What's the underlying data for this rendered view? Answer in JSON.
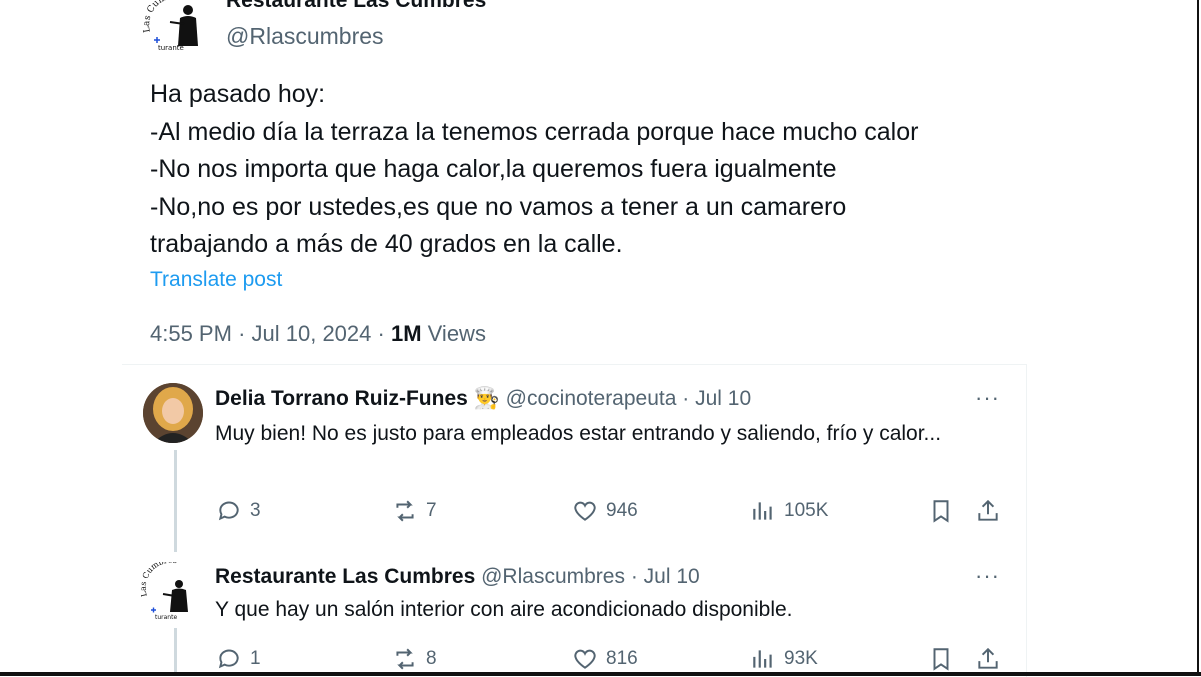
{
  "post": {
    "author_name": "Restaurante Las Cumbres",
    "author_handle": "@Rlascumbres",
    "lines": [
      "Ha pasado hoy:",
      "-Al medio día la terraza la tenemos cerrada porque hace mucho calor",
      "-No nos importa que haga calor,la queremos fuera igualmente",
      "-No,no es por ustedes,es que no vamos a tener a un camarero",
      "trabajando a más de 40 grados en la calle."
    ],
    "translate_label": "Translate post",
    "time": "4:55 PM",
    "date": "Jul 10, 2024",
    "views_count": "1M",
    "views_label": "Views",
    "separator": "·"
  },
  "logo": {
    "arc_text": "Las Cumbres",
    "small_text": "turante",
    "icon": "chef-silhouette-icon"
  },
  "replies": [
    {
      "name": "Delia Torrano Ruiz-Funes",
      "emoji": "👨‍🍳",
      "handle": "@cocinoterapeuta",
      "date": "Jul 10",
      "text": "Muy bien! No es justo para empleados estar entrando y saliendo, frío y calor...",
      "replies": "3",
      "reposts": "7",
      "likes": "946",
      "views": "105K",
      "more": "···"
    },
    {
      "name": "Restaurante Las Cumbres",
      "emoji": "",
      "handle": "@Rlascumbres",
      "date": "Jul 10",
      "text": "Y que hay un salón interior con aire acondicionado disponible.",
      "replies": "1",
      "reposts": "8",
      "likes": "816",
      "views": "93K",
      "more": "···"
    }
  ],
  "colors": {
    "text": "#0f1419",
    "muted": "#536471",
    "link": "#1d9bf0",
    "border": "#eff3f4",
    "thread": "#cfd9de"
  }
}
